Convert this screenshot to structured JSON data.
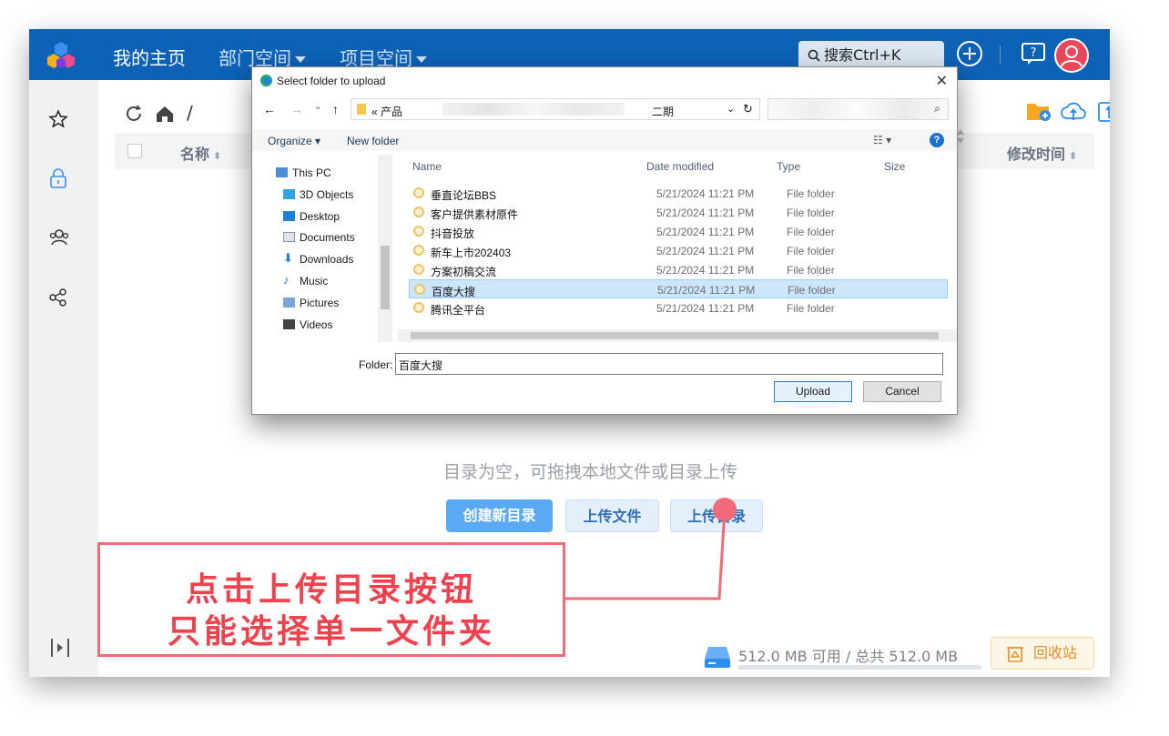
{
  "header": {
    "nav": [
      "我的主页",
      "部门空间",
      "项目空间"
    ],
    "search_label": "搜索Ctrl+K",
    "icons": [
      "logo-cubes-icon",
      "search-icon",
      "plus-circle-icon",
      "help-icon",
      "user-avatar-icon"
    ]
  },
  "sidebar": {
    "icons": [
      "star-icon",
      "lock-icon",
      "group-icon",
      "share-icon",
      "collapse-sidebar-icon"
    ]
  },
  "main": {
    "path_root": "/",
    "columns": {
      "name": "名称",
      "modified": "修改时间"
    },
    "empty_hint": "目录为空，可拖拽本地文件或目录上传",
    "buttons": {
      "create": "创建新目录",
      "upload_file": "上传文件",
      "upload_dir": "上传目录"
    },
    "storage_text": "512.0 MB 可用 / 总共 512.0 MB",
    "storage_used_fraction": 0,
    "trash_label": "回收站"
  },
  "dialog": {
    "title": "Select folder to upload",
    "address_prefix": "«  产品",
    "address_tail": "二期",
    "commands": {
      "organize": "Organize",
      "new_folder": "New folder"
    },
    "nav": [
      "This PC",
      "3D Objects",
      "Desktop",
      "Documents",
      "Downloads",
      "Music",
      "Pictures",
      "Videos"
    ],
    "columns": {
      "name": "Name",
      "date": "Date modified",
      "type": "Type",
      "size": "Size"
    },
    "rows": [
      {
        "name": "垂直论坛BBS",
        "date": "5/21/2024 11:21 PM",
        "type": "File folder",
        "selected": false
      },
      {
        "name": "客户提供素材原件",
        "date": "5/21/2024 11:21 PM",
        "type": "File folder",
        "selected": false
      },
      {
        "name": "抖音投放",
        "date": "5/21/2024 11:21 PM",
        "type": "File folder",
        "selected": false
      },
      {
        "name": "新车上市202403",
        "date": "5/21/2024 11:21 PM",
        "type": "File folder",
        "selected": false
      },
      {
        "name": "方案初稿交流",
        "date": "5/21/2024 11:21 PM",
        "type": "File folder",
        "selected": false
      },
      {
        "name": "百度大搜",
        "date": "5/21/2024 11:21 PM",
        "type": "File folder",
        "selected": true
      },
      {
        "name": "腾讯全平台",
        "date": "5/21/2024 11:21 PM",
        "type": "File folder",
        "selected": false
      }
    ],
    "folder_label": "Folder:",
    "folder_value": "百度大搜",
    "upload_label": "Upload",
    "cancel_label": "Cancel"
  },
  "annotation": {
    "line1": "点击上传目录按钮",
    "line2": "只能选择单一文件夹",
    "color": "#f0424e"
  }
}
